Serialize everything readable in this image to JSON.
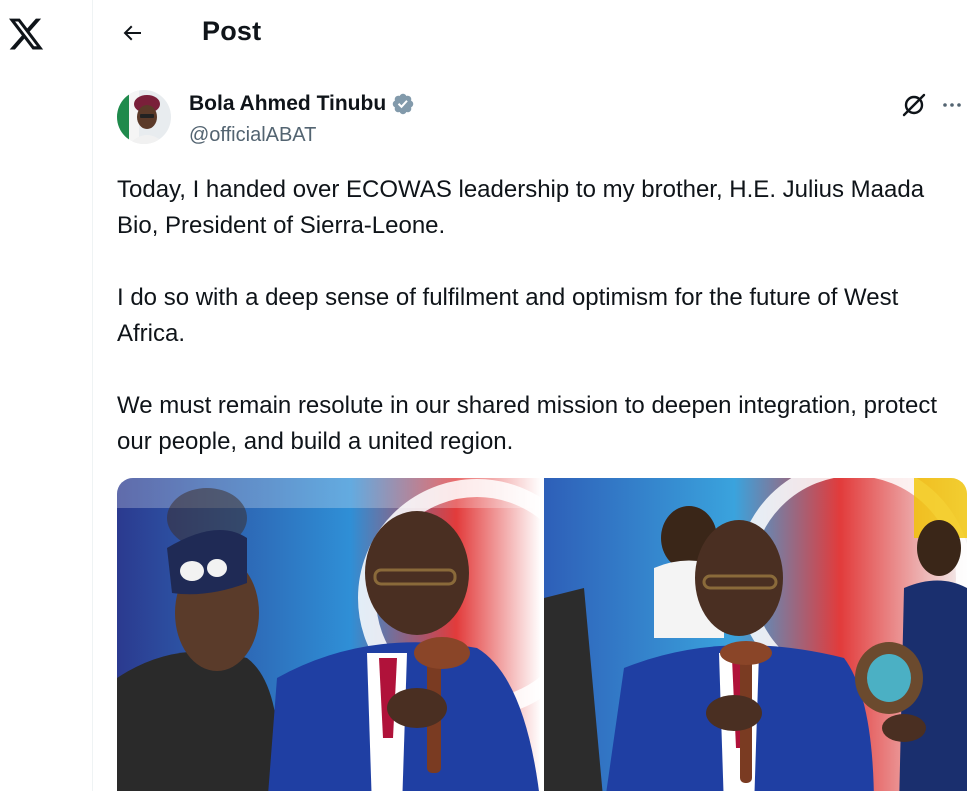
{
  "header": {
    "title": "Post"
  },
  "post": {
    "author_name": "Bola Ahmed Tinubu",
    "handle": "@officialABAT",
    "paragraphs": [
      "Today, I handed over ECOWAS leadership to my brother, H.E. Julius Maada Bio, President of Sierra-Leone.",
      "I do so with a deep sense of fulfilment and optimism for the future of West Africa.",
      "We must remain resolute in our shared mission to deepen integration, protect our people, and build a united region."
    ]
  },
  "icons": {
    "logo": "x-logo-icon",
    "back": "arrow-left-icon",
    "verified": "verified-badge-icon",
    "grok": "grok-icon",
    "more": "more-horizontal-icon"
  },
  "colors": {
    "text_primary": "#0f1419",
    "text_secondary": "#536471",
    "verified_badge": "#829aab",
    "divider": "#eff3f4"
  }
}
